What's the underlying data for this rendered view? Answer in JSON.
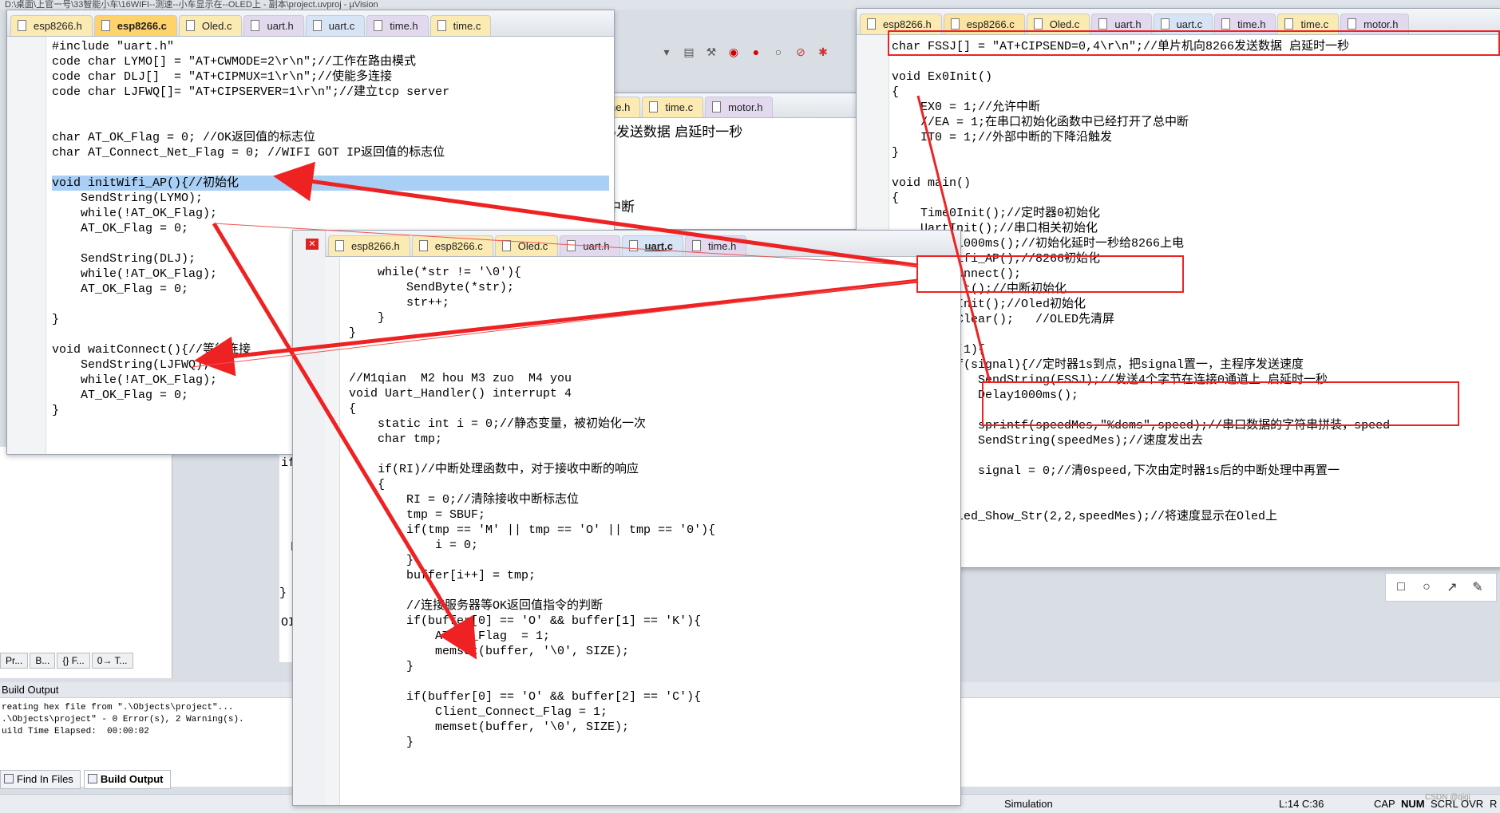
{
  "window_title": "D:\\桌面\\上官一号\\33智能小车\\16WIFI--测速--小车显示在--OLED上 - 副本\\project.uvproj - µVision",
  "left_window": {
    "tabs": [
      "esp8266.h",
      "esp8266.c",
      "Oled.c",
      "uart.h",
      "uart.c",
      "time.h",
      "time.c"
    ],
    "active_tab": "esp8266.c",
    "lines": [
      "#include \"uart.h\"",
      "code char LYMO[] = \"AT+CWMODE=2\\r\\n\";//工作在路由模式",
      "code char DLJ[]  = \"AT+CIPMUX=1\\r\\n\";//使能多连接",
      "code char LJFWQ[]= \"AT+CIPSERVER=1\\r\\n\";//建立tcp server",
      "",
      "",
      "char AT_OK_Flag = 0; //OK返回值的标志位",
      "char AT_Connect_Net_Flag = 0; //WIFI GOT IP返回值的标志位",
      "",
      "void initWifi_AP(){//初始化",
      "    SendString(LYMO);",
      "    while(!AT_OK_Flag);",
      "    AT_OK_Flag = 0;",
      "",
      "    SendString(DLJ);",
      "    while(!AT_OK_Flag);",
      "    AT_OK_Flag = 0;",
      "",
      "}",
      "",
      "void waitConnect(){//等待连接",
      "    SendString(LJFWQ);",
      "    while(!AT_OK_Flag);",
      "    AT_OK_Flag = 0;",
      "}"
    ]
  },
  "mid_back_window": {
    "tabs": [
      "time.h",
      "time.c",
      "motor.h"
    ],
    "snippet_1": "6发送数据 启延时一秒",
    "snippet_2": "中断"
  },
  "center_window": {
    "tabs": [
      "esp8266.h",
      "esp8266.c",
      "Oled.c",
      "uart.h",
      "uart.c",
      "time.h"
    ],
    "active_tab": "uart.c",
    "lines": [
      "    while(*str != '\\0'){",
      "        SendByte(*str);",
      "        str++;",
      "    }",
      "}",
      "",
      "",
      "//M1qian  M2 hou M3 zuo  M4 you",
      "void Uart_Handler() interrupt 4",
      "{",
      "    static int i = 0;//静态变量，被初始化一次",
      "    char tmp;",
      "",
      "    if(RI)//中断处理函数中，对于接收中断的响应",
      "    {",
      "        RI = 0;//清除接收中断标志位",
      "        tmp = SBUF;",
      "        if(tmp == 'M' || tmp == 'O' || tmp == '0'){",
      "            i = 0;",
      "        }",
      "        buffer[i++] = tmp;",
      "",
      "        //连接服务器等OK返回值指令的判断",
      "        if(buffer[0] == 'O' && buffer[1] == 'K'){",
      "            AT_OK_Flag  = 1;",
      "            memset(buffer, '\\0', SIZE);",
      "        }",
      "",
      "        if(buffer[0] == 'O' && buffer[2] == 'C'){",
      "            Client_Connect_Flag = 1;",
      "            memset(buffer, '\\0', SIZE);",
      "        }"
    ]
  },
  "right_window": {
    "tabs": [
      "esp8266.h",
      "esp8266.c",
      "Oled.c",
      "uart.h",
      "uart.c",
      "time.h",
      "time.c",
      "motor.h"
    ],
    "active_tab": "esp8266.c",
    "lines": [
      "char FSSJ[] = \"AT+CIPSEND=0,4\\r\\n\";//单片机向8266发送数据 启延时一秒",
      "",
      "void Ex0Init()",
      "{",
      "    EX0 = 1;//允许中断",
      "    //EA = 1;在串口初始化函数中已经打开了总中断",
      "    IT0 = 1;//外部中断的下降沿触发",
      "}",
      "",
      "void main()",
      "{",
      "    Time0Init();//定时器0初始化",
      "    UartInit();//串口相关初始化",
      "    Delay1000ms();//初始化延时一秒给8266上电",
      "    initWifi_AP();//8266初始化",
      "    waitConnect();",
      "    Ex0Init();//中断初始化",
      "    Oled_Init();//Oled初始化",
      "    Oled_Clear();   //OLED先清屏",
      "",
      "    while(1){",
      "        if(signal){//定时器1s到点，把signal置一，主程序发送速度",
      "            SendString(FSSJ);//发送4个字节在连接0通道上 启延时一秒",
      "            Delay1000ms();",
      "",
      "            sprintf(speedMes,\"%dcms\",speed);//串口数据的字符串拼装，speed",
      "            SendString(speedMes);//速度发出去",
      "",
      "            signal = 0;//清0speed,下次由定时器1s后的中断处理中再置一",
      "        }",
      "",
      "        Oled_Show_Str(2,2,speedMes);//将速度显示在Oled上",
      "    }"
    ]
  },
  "build_output": {
    "title": "Build Output",
    "lines": [
      "reating hex file from \".\\Objects\\project\"...",
      ".\\Objects\\project\" - 0 Error(s), 2 Warning(s).",
      "uild Time Elapsed:  00:00:02"
    ],
    "tabs": [
      "Find In Files",
      "Build Output"
    ]
  },
  "project_tabs": [
    "Pr...",
    "B...",
    "{} F...",
    "0→ T..."
  ],
  "status": {
    "mode": "Simulation",
    "position": "L:14 C:36",
    "caps": "CAP",
    "num": "NUM",
    "scrl": "SCRL",
    "ovr": "OVR",
    "r": "R",
    "watermark": "CSDN @qiqi"
  },
  "behind_snippets": {
    "n1": "1",
    "if_text": "if",
    "h_text": "h",
    "oi_text": "OI",
    "brace": "}"
  },
  "colors": {
    "accent_red": "#e22222",
    "highlight_line": "#a9cff5",
    "active_tab": "#ffd36a"
  }
}
